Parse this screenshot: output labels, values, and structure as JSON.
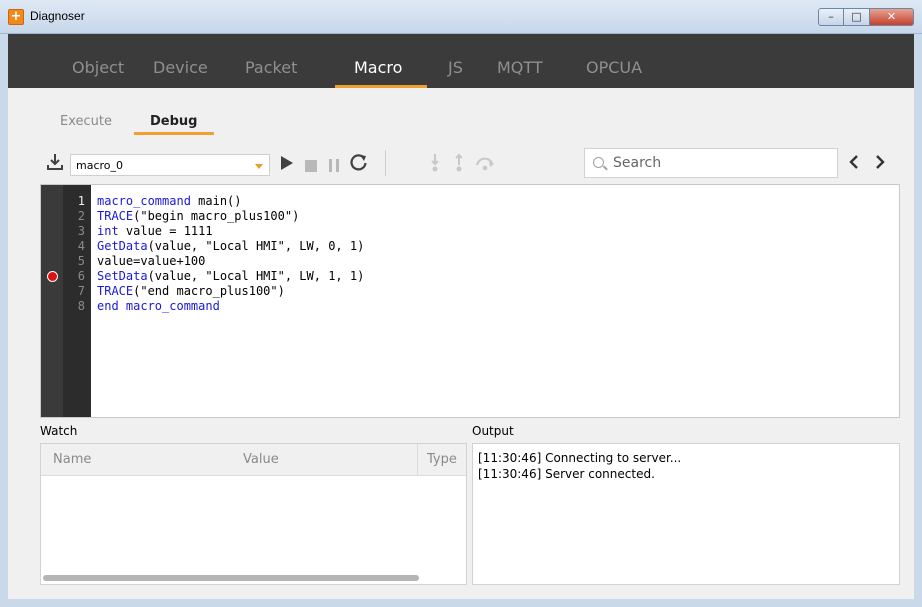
{
  "window": {
    "title": "Diagnoser",
    "icon": "app-icon",
    "controls": [
      "minimize",
      "maximize",
      "close"
    ]
  },
  "topnav": {
    "tabs": [
      "Object",
      "Device",
      "Packet",
      "Macro",
      "JS",
      "MQTT",
      "OPCUA"
    ],
    "active": "Macro",
    "accent": "#f0a030"
  },
  "subtabs": {
    "items": [
      "Execute",
      "Debug"
    ],
    "active": "Debug"
  },
  "toolbar": {
    "download_icon": "download-icon",
    "macro_select": {
      "value": "macro_0"
    },
    "run_icon": "play-icon",
    "stop_icon": "stop-icon",
    "pause_icon": "pause-icon",
    "refresh_icon": "refresh-icon",
    "step_into_icon": "step-into-icon",
    "step_out_icon": "step-out-icon",
    "step_over_icon": "step-over-icon",
    "search_placeholder": "Search",
    "prev_icon": "chevron-left-icon",
    "next_icon": "chevron-right-icon"
  },
  "editor": {
    "lines": [
      {
        "n": "1",
        "kw": "macro_command",
        "rest": " main()"
      },
      {
        "n": "2",
        "kw": "TRACE",
        "rest": "(\"begin macro_plus100\")"
      },
      {
        "n": "3",
        "kw": "int",
        "rest": " value = 1111"
      },
      {
        "n": "4",
        "kw": "GetData",
        "rest": "(value, \"Local HMI\", LW, 0, 1)"
      },
      {
        "n": "5",
        "kw": "",
        "rest": "value=value+100"
      },
      {
        "n": "6",
        "kw": "SetData",
        "rest": "(value, \"Local HMI\", LW, 1, 1)"
      },
      {
        "n": "7",
        "kw": "TRACE",
        "rest": "(\"end macro_plus100\")"
      },
      {
        "n": "8",
        "kw": "end macro_command",
        "rest": ""
      }
    ],
    "breakpoint_line": 6,
    "breakpoint_color": "#e01010"
  },
  "watch": {
    "label": "Watch",
    "columns": [
      "Name",
      "Value",
      "Type"
    ]
  },
  "output": {
    "label": "Output",
    "lines": [
      "[11:30:46] Connecting to server...",
      "[11:30:46] Server connected."
    ]
  }
}
